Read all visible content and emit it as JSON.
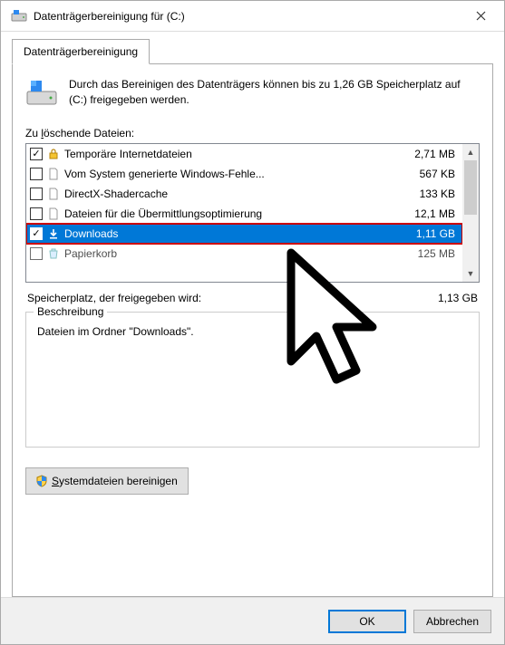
{
  "titlebar": {
    "title": "Datenträgerbereinigung für  (C:)"
  },
  "tabs": {
    "main": "Datenträgerbereinigung"
  },
  "info": {
    "text": "Durch das Bereinigen des Datenträgers können bis zu 1,26 GB Speicherplatz auf  (C:) freigegeben werden."
  },
  "labels": {
    "files_to_delete": "Zu löschende Dateien:",
    "freed_space": "Speicherplatz, der freigegeben wird:",
    "description_legend": "Beschreibung"
  },
  "file_list": {
    "items": [
      {
        "checked": true,
        "icon": "lock",
        "label": "Temporäre Internetdateien",
        "size": "2,71 MB"
      },
      {
        "checked": false,
        "icon": "file",
        "label": "Vom System generierte Windows-Fehle...",
        "size": "567 KB"
      },
      {
        "checked": false,
        "icon": "file",
        "label": "DirectX-Shadercache",
        "size": "133 KB"
      },
      {
        "checked": false,
        "icon": "file",
        "label": "Dateien für die Übermittlungsoptimierung",
        "size": "12,1 MB"
      },
      {
        "checked": true,
        "icon": "download",
        "label": "Downloads",
        "size": "1,11 GB",
        "selected": true
      },
      {
        "checked": false,
        "icon": "recycle",
        "label": "Papierkorb",
        "size": "125 MB"
      }
    ]
  },
  "freed_value": "1,13 GB",
  "description": {
    "text": "Dateien im Ordner \"Downloads\"."
  },
  "buttons": {
    "sysfiles": "Systemdateien bereinigen",
    "ok": "OK",
    "cancel": "Abbrechen"
  }
}
